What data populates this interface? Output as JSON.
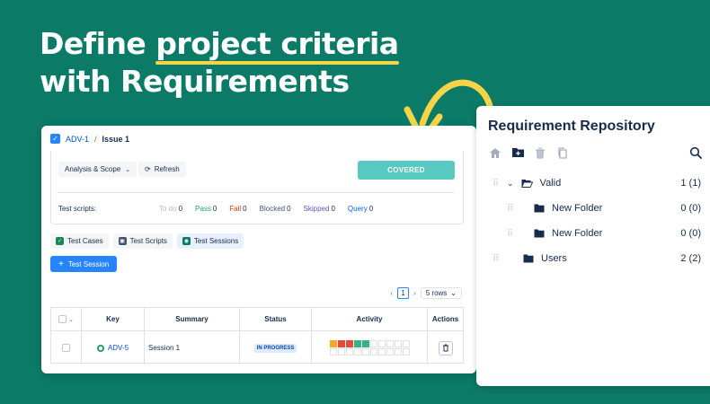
{
  "headline": {
    "line1_prefix": "Define ",
    "line1_highlight": "project criteria",
    "line2": "with Requirements"
  },
  "issue": {
    "breadcrumb": {
      "project": "ADV-1",
      "separator": "/",
      "current": "Issue 1"
    },
    "toolbar": {
      "scope_label": "Analysis & Scope",
      "refresh_label": "Refresh",
      "status_label": "COVERED"
    },
    "stats": {
      "label": "Test scripts:",
      "items": [
        {
          "name": "To do",
          "value": "0",
          "color": "#b3bac5"
        },
        {
          "name": "Pass",
          "value": "0",
          "color": "#22a06b"
        },
        {
          "name": "Fail",
          "value": "0",
          "color": "#de350b"
        },
        {
          "name": "Blocked",
          "value": "0",
          "color": "#42526e"
        },
        {
          "name": "Skipped",
          "value": "0",
          "color": "#6554c0"
        },
        {
          "name": "Query",
          "value": "0",
          "color": "#0065ff"
        }
      ]
    },
    "tabs": [
      {
        "label": "Test Cases",
        "icon": "test-cases-icon",
        "color": "#1f845a"
      },
      {
        "label": "Test Scripts",
        "icon": "test-scripts-icon",
        "color": "#42526e"
      },
      {
        "label": "Test Sessions",
        "icon": "test-sessions-icon",
        "color": "#0b7a66",
        "active": true
      }
    ],
    "add_session_label": "Test Session",
    "pager": {
      "page": "1",
      "rows": "5 rows"
    },
    "table": {
      "headers": [
        "Key",
        "Summary",
        "Status",
        "Activity",
        "Actions"
      ],
      "rows": [
        {
          "key": "ADV-5",
          "summary": "Session 1",
          "status": "IN PROGRESS",
          "activity": [
            "#f5a623",
            "#e5493a",
            "#e5493a",
            "#36b37e",
            "#36b37e"
          ]
        }
      ]
    }
  },
  "repository": {
    "title": "Requirement Repository",
    "toolbar_icons": [
      "home-icon",
      "new-folder-icon",
      "trash-icon",
      "copy-icon"
    ],
    "search_icon": "search-icon",
    "tree": [
      {
        "label": "Valid",
        "count": "1 (1)",
        "level": 0,
        "expanded": true
      },
      {
        "label": "New Folder",
        "count": "0 (0)",
        "level": 1
      },
      {
        "label": "New Folder",
        "count": "0 (0)",
        "level": 1
      },
      {
        "label": "Users",
        "count": "2 (2)",
        "level": 0
      }
    ]
  },
  "colors": {
    "background": "#0b7a66",
    "accent_highlight": "#f5d547",
    "primary_button": "#2684ff",
    "covered": "#57c9c1"
  }
}
